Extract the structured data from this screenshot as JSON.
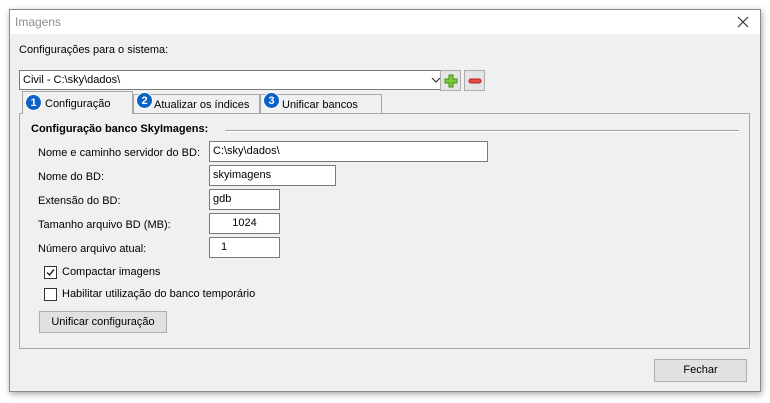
{
  "window": {
    "title": "Imagens"
  },
  "system_config": {
    "label": "Configurações para o sistema:",
    "selected": "Civil - C:\\sky\\dados\\"
  },
  "tabs": [
    {
      "number": "1",
      "label": "Configuração"
    },
    {
      "number": "2",
      "label": "Atualizar os índices"
    },
    {
      "number": "3",
      "label": "Unificar bancos"
    }
  ],
  "group": {
    "title": "Configuração banco SkyImagens:",
    "fields": [
      {
        "label": "Nome e caminho servidor do BD:",
        "value": "C:\\sky\\dados\\"
      },
      {
        "label": "Nome do BD:",
        "value": "skyimagens"
      },
      {
        "label": "Extensão do BD:",
        "value": "gdb"
      },
      {
        "label": "Tamanho arquivo BD (MB):",
        "value": "1024"
      },
      {
        "label": "Número arquivo atual:",
        "value": "1"
      }
    ],
    "checkboxes": [
      {
        "label": "Compactar imagens",
        "checked": true
      },
      {
        "label": "Habilitar utilização do banco temporário",
        "checked": false
      }
    ],
    "unify_button": "Unificar configuração"
  },
  "footer": {
    "close_button": "Fechar"
  }
}
